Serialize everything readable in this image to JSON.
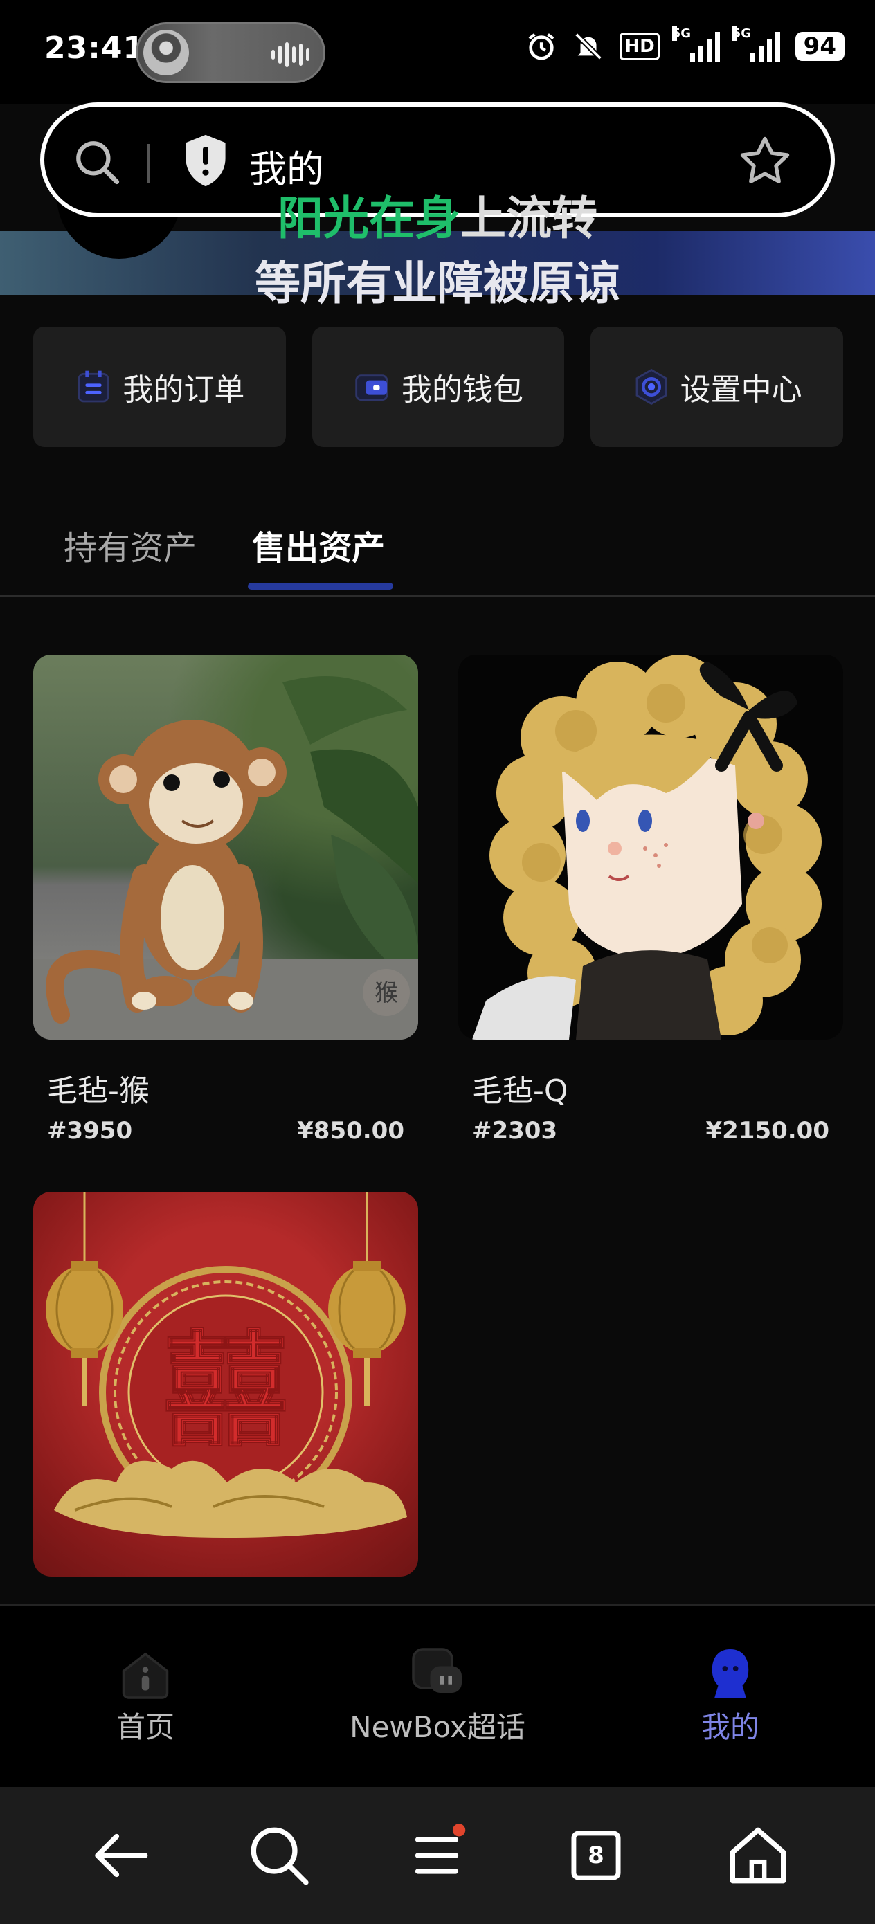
{
  "status_bar": {
    "time": "23:41",
    "hd_badge": "HD",
    "signal_1": "5G",
    "signal_2": "5G",
    "battery": "94"
  },
  "search": {
    "text": "我的"
  },
  "banner": {
    "lyric_line1_highlight": "阳光在身",
    "lyric_line1_rest": "上流转",
    "lyric_line2": "等所有业障被原谅"
  },
  "quick_actions": [
    {
      "label": "我的订单",
      "icon": "order-icon"
    },
    {
      "label": "我的钱包",
      "icon": "wallet-icon"
    },
    {
      "label": "设置中心",
      "icon": "settings-icon"
    }
  ],
  "tabs": [
    {
      "label": "持有资产",
      "active": false
    },
    {
      "label": "售出资产",
      "active": true
    }
  ],
  "assets": [
    {
      "name": "毛毡-猴",
      "id": "#3950",
      "price": "¥850.00",
      "image": "felt-monkey-image",
      "watermark": "猴"
    },
    {
      "name": "毛毡-Q",
      "id": "#2303",
      "price": "¥2150.00",
      "image": "felt-girl-image"
    },
    {
      "name": "",
      "id": "",
      "price": "",
      "image": "double-happiness-lantern-image",
      "symbol": "囍"
    }
  ],
  "bottom_nav": [
    {
      "label": "首页",
      "icon": "home-icon",
      "active": false
    },
    {
      "label": "NewBox超话",
      "icon": "chat-icon",
      "active": false
    },
    {
      "label": "我的",
      "icon": "profile-icon",
      "active": true
    }
  ],
  "system_nav": {
    "tab_count": "8",
    "icons": [
      "back-arrow-icon",
      "search-icon",
      "menu-icon",
      "tabs-icon",
      "home-icon"
    ]
  },
  "colors": {
    "accent": "#263a9e",
    "active_nav": "#7f85e6",
    "lyric_highlight": "#1fbe6a",
    "card_bg": "#1e1e1e"
  }
}
